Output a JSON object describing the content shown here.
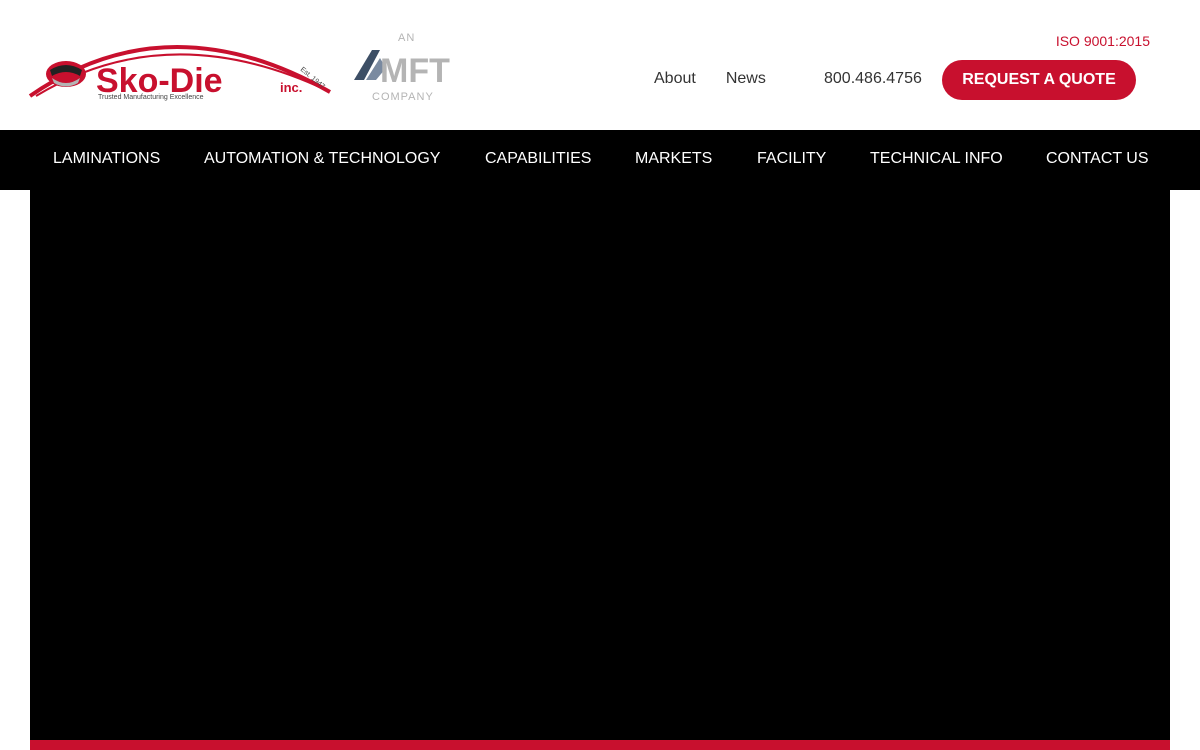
{
  "brand": {
    "logo_name": "Sko-Die",
    "logo_suffix": "inc.",
    "logo_tagline": "Trusted Manufacturing Excellence",
    "logo_est": "Est. 1947",
    "parent_top": "AN",
    "parent_mark": "MFT",
    "parent_bottom": "COMPANY",
    "accent_color": "#c8102e",
    "gray_color": "#b4b4b4",
    "slate_color": "#3d4f66"
  },
  "header": {
    "iso": "ISO 9001:2015",
    "links": [
      {
        "label": "About"
      },
      {
        "label": "News"
      }
    ],
    "phone": "800.486.4756",
    "cta_label": "REQUEST A QUOTE"
  },
  "nav": {
    "items": [
      {
        "label": "LAMINATIONS"
      },
      {
        "label": "AUTOMATION & TECHNOLOGY"
      },
      {
        "label": "CAPABILITIES"
      },
      {
        "label": "MARKETS"
      },
      {
        "label": "FACILITY"
      },
      {
        "label": "TECHNICAL INFO"
      },
      {
        "label": "CONTACT US"
      }
    ]
  }
}
